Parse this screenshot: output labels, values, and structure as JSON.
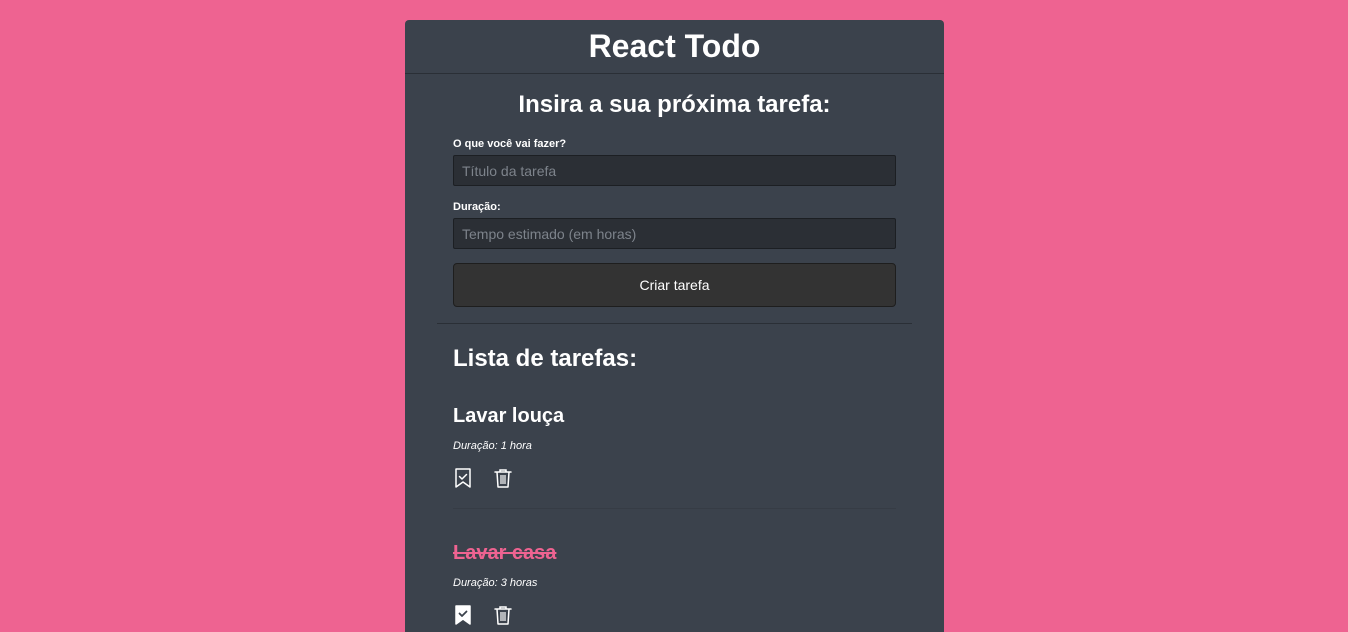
{
  "app": {
    "title": "React Todo"
  },
  "form": {
    "heading": "Insira a sua próxima tarefa:",
    "title_label": "O que você vai fazer?",
    "title_placeholder": "Título da tarefa",
    "title_value": "",
    "duration_label": "Duração:",
    "duration_placeholder": "Tempo estimado (em horas)",
    "duration_value": "",
    "submit_label": "Criar tarefa"
  },
  "list": {
    "heading": "Lista de tarefas:",
    "tasks": [
      {
        "title": "Lavar louça",
        "duration": "Duração: 1 hora",
        "done": false,
        "toggle_icon": "bookmark-check-outline-icon",
        "delete_icon": "trash-icon"
      },
      {
        "title": "Lavar casa",
        "duration": "Duração: 3 horas",
        "done": true,
        "toggle_icon": "bookmark-check-filled-icon",
        "delete_icon": "trash-icon"
      }
    ]
  },
  "colors": {
    "background": "#ee6391",
    "panel": "#3b424c",
    "input": "#2b2f35",
    "button": "#333333",
    "done_accent": "#ee6391"
  }
}
